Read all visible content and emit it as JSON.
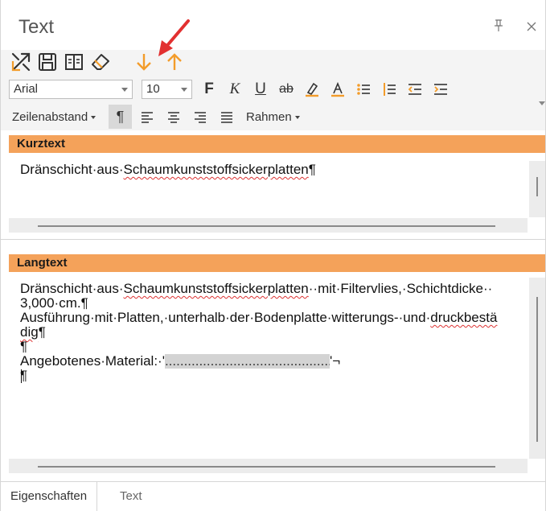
{
  "window": {
    "title": "Text",
    "pin_symbol": "〒",
    "close_symbol": "×"
  },
  "toolbar": {
    "icons": [
      "expand-icon",
      "save-icon",
      "columns-icon",
      "eraser-icon",
      "move-down-icon",
      "move-up-icon"
    ],
    "font_family": "Arial",
    "font_size": "10",
    "bold_glyph": "F",
    "italic_glyph": "K",
    "underline_glyph": "U",
    "strike_glyph": "ab",
    "line_spacing_label": "Zeilenabstand",
    "paragraph_mark": "¶",
    "border_label": "Rahmen"
  },
  "colors": {
    "accent": "#f4a25a",
    "arrow_orange": "#f39c2a",
    "annotation_red": "#e23030"
  },
  "kurztext": {
    "header": "Kurztext",
    "line1_a": "Dränschicht·aus·",
    "line1_b": "Schaumkunststoffsickerplatten",
    "line1_c": "¶"
  },
  "langtext": {
    "header": "Langtext",
    "l1_a": "Dränschicht·aus·",
    "l1_b": "Schaumkunststoffsickerplatten",
    "l1_c": "··mit·Filtervlies,·Schichtdicke··",
    "l2": "3,000·cm.¶",
    "l3_a": "Ausführung·mit·Platten,·unterhalb·der·Bodenplatte·witterungs-·und·",
    "l3_b": "druckbestä",
    "l4_a": "dig",
    "l4_b": "¶",
    "l5": "¶",
    "l6_a": "Angebotenes·Material:·'",
    "l6_b": "..................................................",
    "l6_c": "'¬",
    "l7": "¶"
  },
  "tabs": {
    "eigenschaften": "Eigenschaften",
    "text": "Text"
  }
}
